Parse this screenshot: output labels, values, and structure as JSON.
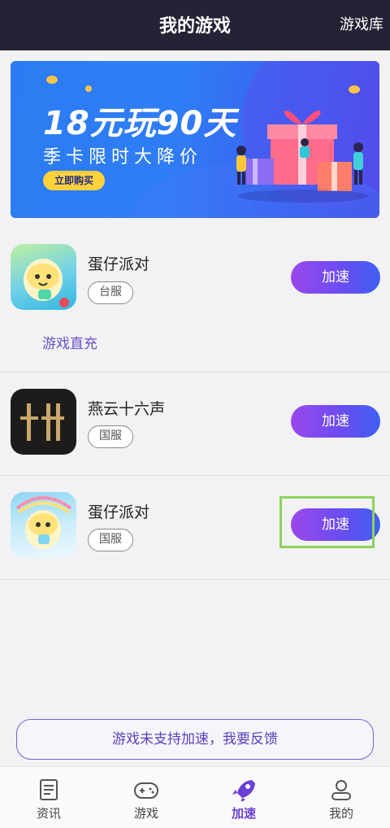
{
  "header": {
    "title": "我的游戏",
    "library_link": "游戏库"
  },
  "banner": {
    "headline": "18元玩90天",
    "subline": "季卡限时大降价",
    "buy_button": "立即购买"
  },
  "games": [
    {
      "name": "蛋仔派对",
      "server": "台服",
      "action": "加速",
      "extra_link": "游戏直充"
    },
    {
      "name": "燕云十六声",
      "server": "国服",
      "action": "加速"
    },
    {
      "name": "蛋仔派对",
      "server": "国服",
      "action": "加速"
    }
  ],
  "feedback_button": "游戏未支持加速，我要反馈",
  "tabs": [
    {
      "label": "资讯",
      "icon": "news-icon"
    },
    {
      "label": "游戏",
      "icon": "gamepad-icon"
    },
    {
      "label": "加速",
      "icon": "rocket-icon",
      "active": true
    },
    {
      "label": "我的",
      "icon": "user-icon"
    }
  ],
  "colors": {
    "accent": "#6b3fd6",
    "header_bg": "#252235",
    "highlight": "#8bd35a"
  }
}
